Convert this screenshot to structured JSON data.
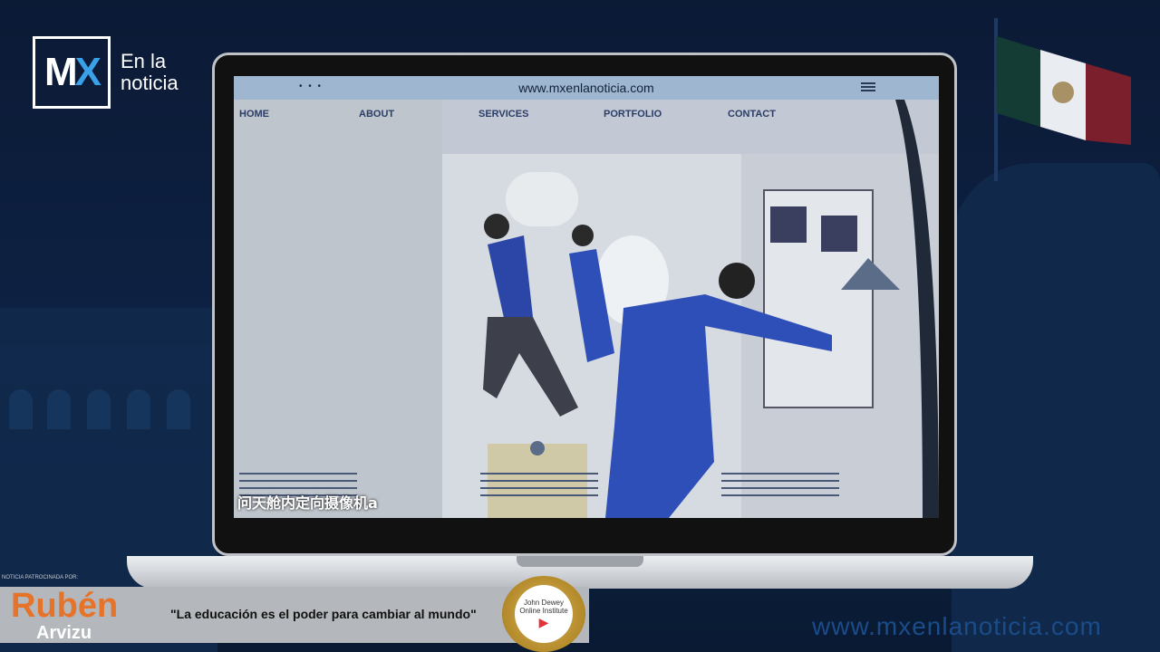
{
  "brand": {
    "logo_text": "MX",
    "logo_x": "X",
    "name_line1": "En la",
    "name_line2": "noticia"
  },
  "browser": {
    "dots": "• • •",
    "url": "www.mxenlanoticia.com",
    "nav": [
      "HOME",
      "ABOUT",
      "SERVICES",
      "PORTFOLIO",
      "CONTACT"
    ]
  },
  "video": {
    "caption": "问天舱内定向摄像机a"
  },
  "advert": {
    "small_label": "NOTICIA PATROCINADA POR:",
    "name": "Rubén",
    "surname": "Arvizu",
    "quote": "\"La educación es el poder para cambiar al mundo\"",
    "badge_line1": "John Dewey",
    "badge_line2": "Online Institute"
  },
  "footer": {
    "url": "www.mxenlanoticia.com"
  },
  "colors": {
    "background": "#0b1b36",
    "accent_blue": "#3aa0e8",
    "ad_orange": "#e5732a"
  }
}
